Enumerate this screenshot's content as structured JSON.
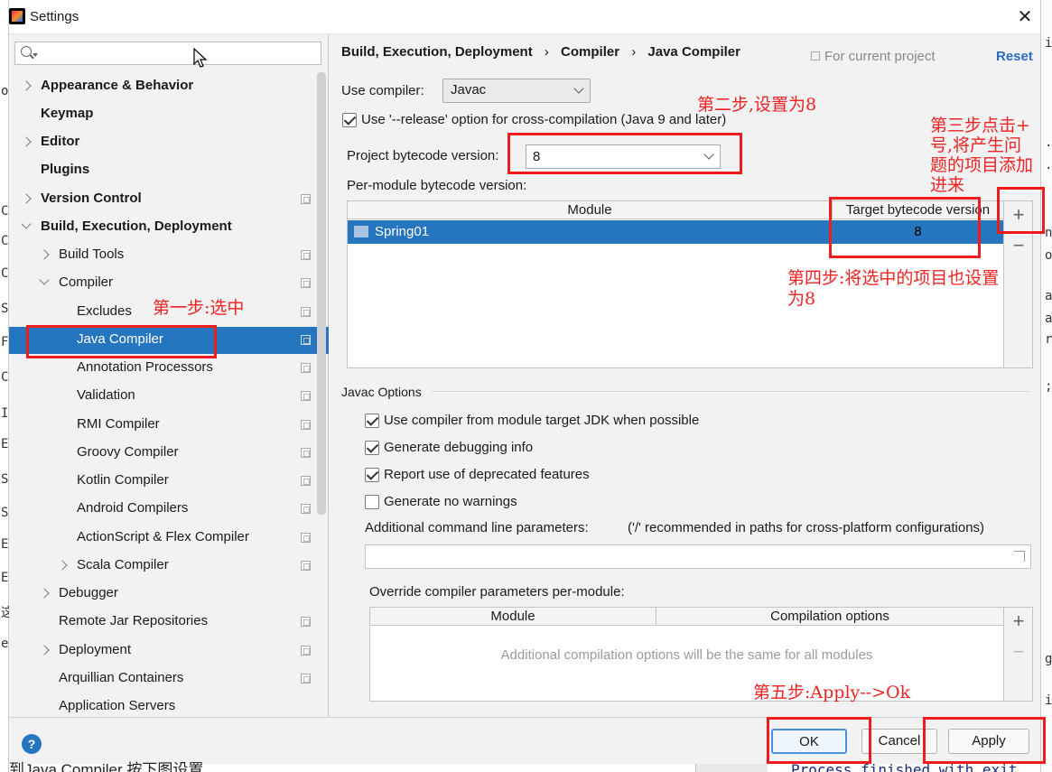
{
  "window": {
    "title": "Settings",
    "close": "✕"
  },
  "search": {
    "placeholder": ""
  },
  "sidebar": {
    "items": [
      {
        "label": "Appearance & Behavior"
      },
      {
        "label": "Keymap"
      },
      {
        "label": "Editor"
      },
      {
        "label": "Plugins"
      },
      {
        "label": "Version Control"
      },
      {
        "label": "Build, Execution, Deployment"
      },
      {
        "label": "Build Tools"
      },
      {
        "label": "Compiler"
      },
      {
        "label": "Excludes"
      },
      {
        "label": "Java Compiler"
      },
      {
        "label": "Annotation Processors"
      },
      {
        "label": "Validation"
      },
      {
        "label": "RMI Compiler"
      },
      {
        "label": "Groovy Compiler"
      },
      {
        "label": "Kotlin Compiler"
      },
      {
        "label": "Android Compilers"
      },
      {
        "label": "ActionScript & Flex Compiler"
      },
      {
        "label": "Scala Compiler"
      },
      {
        "label": "Debugger"
      },
      {
        "label": "Remote Jar Repositories"
      },
      {
        "label": "Deployment"
      },
      {
        "label": "Arquillian Containers"
      },
      {
        "label": "Application Servers"
      }
    ]
  },
  "breadcrumb": {
    "part1": "Build, Execution, Deployment",
    "sep": "›",
    "part2": "Compiler",
    "part3": "Java Compiler"
  },
  "header": {
    "for_current_project": "For current project",
    "reset": "Reset"
  },
  "compiler": {
    "use_compiler_label": "Use compiler:",
    "use_compiler_value": "Javac",
    "release_option_label": "Use '--release' option for cross-compilation (Java 9 and later)",
    "release_option_checked": true,
    "project_bytecode_label": "Project bytecode version:",
    "project_bytecode_value": "8",
    "per_module_label": "Per-module bytecode version:"
  },
  "module_table": {
    "headers": [
      "Module",
      "Target bytecode version"
    ],
    "rows": [
      {
        "module": "Spring01",
        "target": "8"
      }
    ]
  },
  "table_tools": {
    "add": "+",
    "remove": "−"
  },
  "javac": {
    "section_label": "Javac Options",
    "options": [
      {
        "label": "Use compiler from module target JDK when possible",
        "checked": true
      },
      {
        "label": "Generate debugging info",
        "checked": true
      },
      {
        "label": "Report use of deprecated features",
        "checked": true
      },
      {
        "label": "Generate no warnings",
        "checked": false
      }
    ],
    "additional_params_label": "Additional command line parameters:",
    "additional_params_hint": "('/' recommended in paths for cross-platform configurations)",
    "additional_params_value": "",
    "override_label": "Override compiler parameters per-module:"
  },
  "override_table": {
    "headers": [
      "Module",
      "Compilation options"
    ],
    "empty_text": "Additional compilation options will be the same for all modules"
  },
  "buttons": {
    "help": "?",
    "ok": "OK",
    "cancel": "Cancel",
    "apply": "Apply"
  },
  "annotations": {
    "step1": "第一步:选中",
    "step2": "第二步,设置为8",
    "step3_l1": "第三步点击+",
    "step3_l2": "号,将产生问",
    "step3_l3": "题的项目添加",
    "step3_l4": "进来",
    "step4_l1": "第四步:将选中的项目也设置",
    "step4_l2": "为8",
    "step5": "第五步:Apply-->Ok"
  },
  "background": {
    "left_chars": [
      "o",
      "C",
      "C",
      "C",
      "S",
      "F",
      "C",
      "I",
      "E",
      "S",
      "S",
      "E",
      "E",
      "这",
      "e"
    ],
    "right_chars": [
      "i",
      ".",
      ".",
      "n",
      "o",
      "a",
      "a",
      "r",
      ";",
      "g",
      "i"
    ],
    "bottom_text": "到Java Compiler 按下图设置",
    "bottom_code": "Process finished with exit"
  },
  "colors": {
    "accent": "#2675bf",
    "annotation": "#ee1c1c",
    "link": "#2b6cc4"
  }
}
